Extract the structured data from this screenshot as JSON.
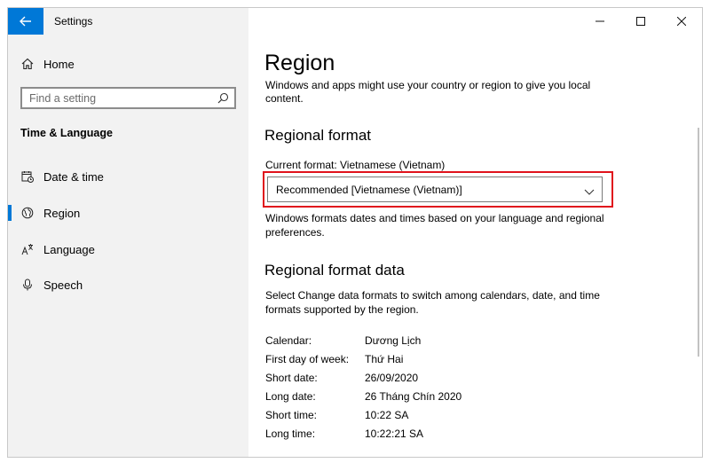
{
  "window": {
    "title": "Settings"
  },
  "sidebar": {
    "home_label": "Home",
    "search_placeholder": "Find a setting",
    "section_title": "Time & Language",
    "items": [
      {
        "label": "Date & time",
        "icon": "calendar-clock-icon",
        "selected": false
      },
      {
        "label": "Region",
        "icon": "globe-region-icon",
        "selected": true
      },
      {
        "label": "Language",
        "icon": "language-icon",
        "selected": false
      },
      {
        "label": "Speech",
        "icon": "microphone-icon",
        "selected": false
      }
    ]
  },
  "main": {
    "page_title": "Region",
    "intro": "Windows and apps might use your country or region to give you local content.",
    "regional_format": {
      "heading": "Regional format",
      "current_label": "Current format: Vietnamese (Vietnam)",
      "dropdown_value": "Recommended [Vietnamese (Vietnam)]",
      "description": "Windows formats dates and times based on your language and regional preferences."
    },
    "regional_format_data": {
      "heading": "Regional format data",
      "description": "Select Change data formats to switch among calendars, date, and time formats supported by the region.",
      "rows": [
        {
          "key": "Calendar:",
          "value": "Dương Lịch"
        },
        {
          "key": "First day of week:",
          "value": "Thứ Hai"
        },
        {
          "key": "Short date:",
          "value": "26/09/2020"
        },
        {
          "key": "Long date:",
          "value": "26 Tháng Chín 2020"
        },
        {
          "key": "Short time:",
          "value": "10:22 SA"
        },
        {
          "key": "Long time:",
          "value": "10:22:21 SA"
        }
      ]
    }
  },
  "colors": {
    "accent": "#0078d7",
    "highlight_box": "#e0131c",
    "sidebar_bg": "#f2f2f2"
  }
}
